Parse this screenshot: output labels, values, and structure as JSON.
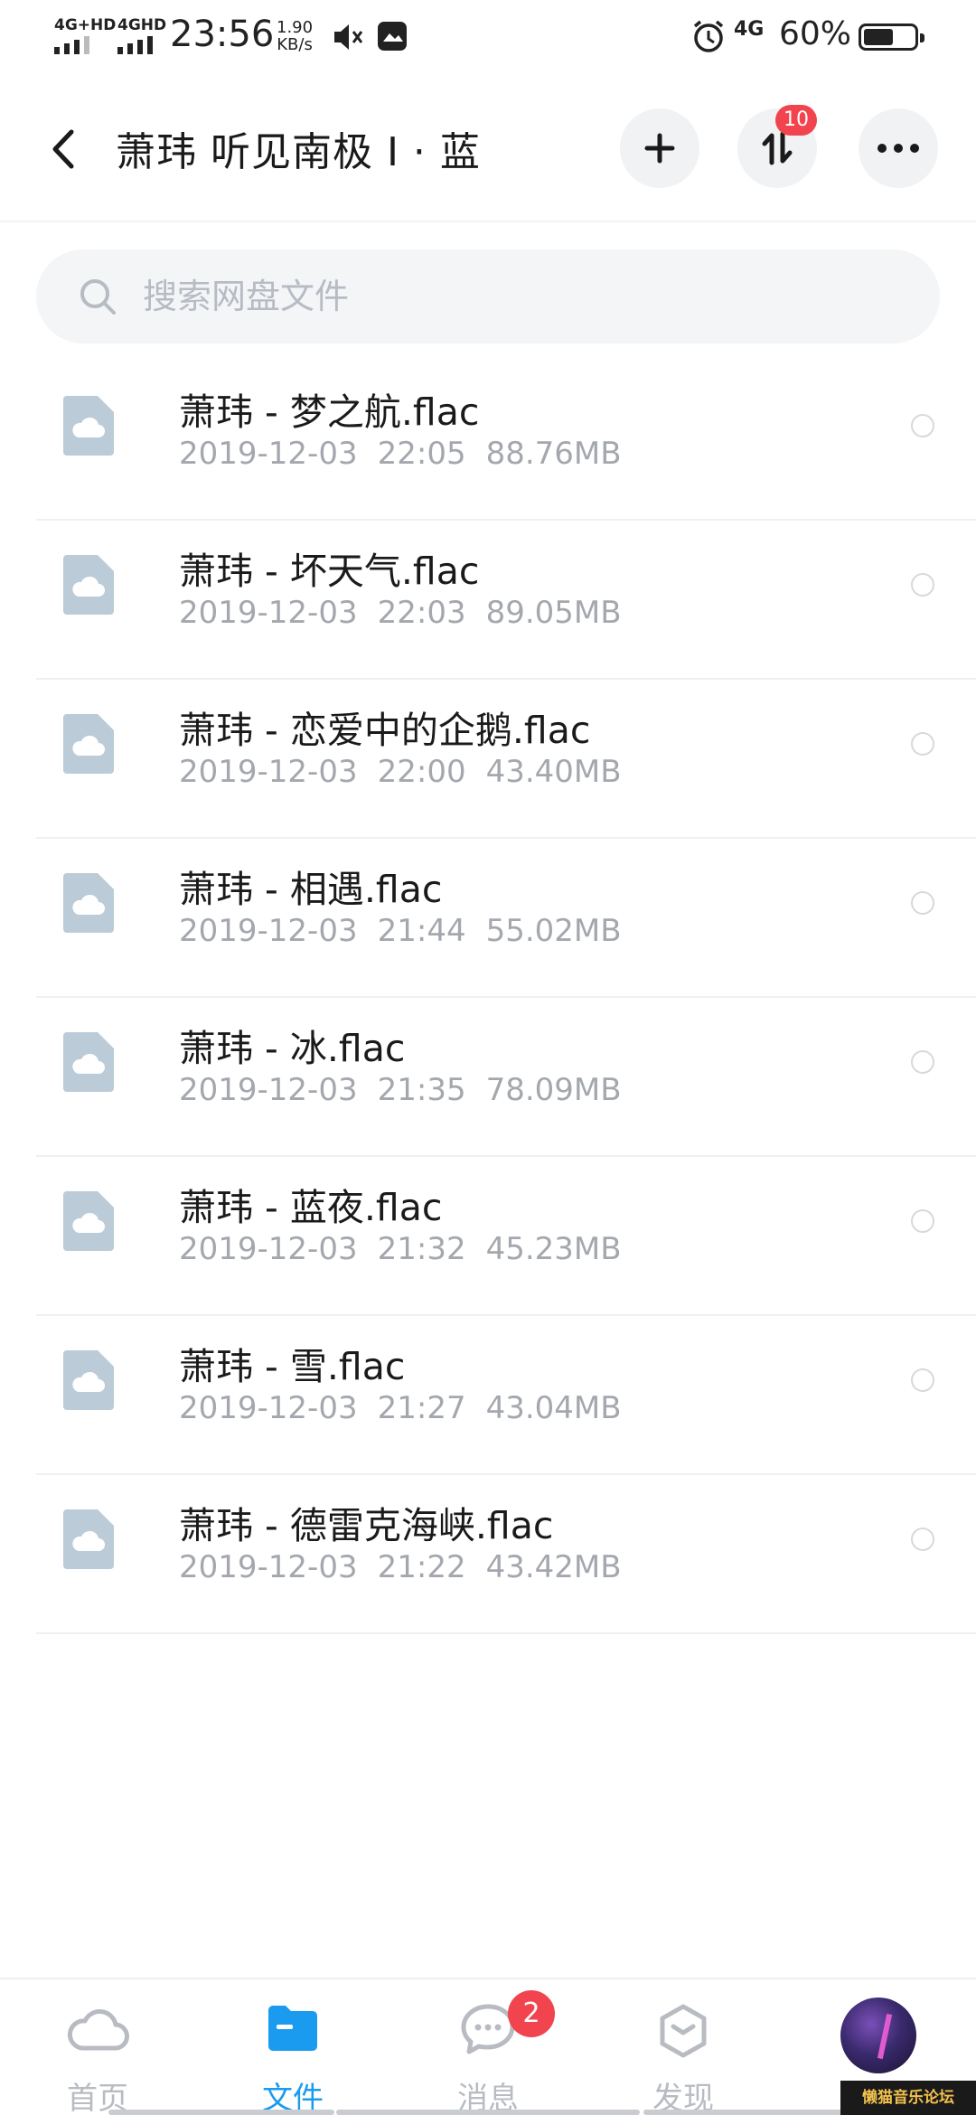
{
  "status_bar": {
    "net1": "4G+HD",
    "net2": "4GHD",
    "time": "23:56",
    "speed_value": "1.90",
    "speed_unit": "KB/s",
    "data_net": "4G",
    "battery_pct": "60%",
    "battery_level": 0.6,
    "icons": [
      "mute-icon",
      "message-icon",
      "alarm-icon",
      "battery-icon"
    ]
  },
  "header": {
    "title": "萧玮  听见南极 I · 蓝",
    "transfer_badge": "10"
  },
  "search": {
    "placeholder": "搜索网盘文件"
  },
  "files": [
    {
      "name": "萧玮 - 梦之航.flac",
      "date": "2019-12-03",
      "time": "22:05",
      "size": "88.76MB"
    },
    {
      "name": "萧玮 - 坏天气.flac",
      "date": "2019-12-03",
      "time": "22:03",
      "size": "89.05MB"
    },
    {
      "name": "萧玮 - 恋爱中的企鹅.flac",
      "date": "2019-12-03",
      "time": "22:00",
      "size": "43.40MB"
    },
    {
      "name": "萧玮 - 相遇.flac",
      "date": "2019-12-03",
      "time": "21:44",
      "size": "55.02MB"
    },
    {
      "name": "萧玮 - 冰.flac",
      "date": "2019-12-03",
      "time": "21:35",
      "size": "78.09MB"
    },
    {
      "name": "萧玮 - 蓝夜.flac",
      "date": "2019-12-03",
      "time": "21:32",
      "size": "45.23MB"
    },
    {
      "name": "萧玮 - 雪.flac",
      "date": "2019-12-03",
      "time": "21:27",
      "size": "43.04MB"
    },
    {
      "name": "萧玮 - 德雷克海峡.flac",
      "date": "2019-12-03",
      "time": "21:22",
      "size": "43.42MB"
    }
  ],
  "bottom_nav": {
    "tabs": [
      {
        "label": "首页",
        "icon": "cloud-icon"
      },
      {
        "label": "文件",
        "icon": "folder-icon"
      },
      {
        "label": "消息",
        "icon": "chat-icon"
      },
      {
        "label": "发现",
        "icon": "discover-icon"
      }
    ],
    "message_badge": "2"
  },
  "watermark": "懒猫音乐论坛",
  "colors": {
    "accent": "#1a9bf0",
    "badge": "#f2444f",
    "file_icon": "#bccbd8",
    "inactive": "#b8bcc2"
  }
}
